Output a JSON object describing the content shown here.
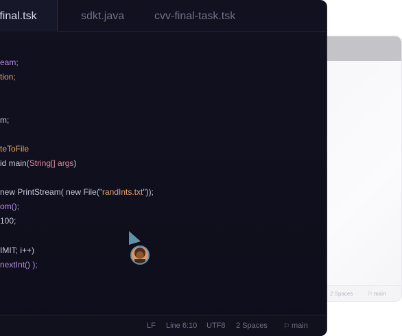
{
  "editor": {
    "tabs": [
      {
        "label": "-final.tsk",
        "active": true
      },
      {
        "label": "sdkt.java",
        "active": false
      },
      {
        "label": "cvv-final-task.tsk",
        "active": false
      }
    ],
    "lines": [
      {
        "parts": [
          {
            "t": "eam;",
            "c": "purple"
          }
        ]
      },
      {
        "parts": [
          {
            "t": "tion;",
            "c": "orange"
          }
        ]
      },
      {
        "parts": [
          {
            "t": "m;",
            "c": "default"
          }
        ]
      },
      {
        "parts": [
          {
            "t": "teToFile",
            "c": "orange"
          }
        ]
      },
      {
        "parts": [
          {
            "t": "id main(",
            "c": "default"
          },
          {
            "t": "String[] args",
            "c": "pink"
          },
          {
            "t": ")",
            "c": "default"
          }
        ]
      },
      {
        "parts": [
          {
            "t": "new PrintStream( new File(\"",
            "c": "default"
          },
          {
            "t": "randInts.txt",
            "c": "orange"
          },
          {
            "t": "\"));",
            "c": "default"
          }
        ]
      },
      {
        "parts": [
          {
            "t": "om();",
            "c": "purple"
          }
        ]
      },
      {
        "parts": [
          {
            "t": "100;",
            "c": "default"
          }
        ]
      },
      {
        "parts": [
          {
            "t": "IMIT; i++)",
            "c": "default"
          }
        ]
      },
      {
        "parts": [
          {
            "t": "nextInt() );",
            "c": "purple"
          }
        ]
      }
    ],
    "status": {
      "lf": "LF",
      "position": "Line 6:10",
      "encoding": "UTF8",
      "indent": "2 Spaces",
      "branch": "main"
    }
  },
  "background_window": {
    "status": {
      "indent": "2 Spaces",
      "branch": "main"
    }
  },
  "colors": {
    "editor_bg": "#11111f",
    "orange": "#e9a36a",
    "purple": "#b58ae8",
    "pink": "#e9839a",
    "cursor": "#6a9fb5"
  },
  "icons": {
    "cursor": "collaborator-cursor-icon",
    "branch": "branch-flag-icon"
  }
}
